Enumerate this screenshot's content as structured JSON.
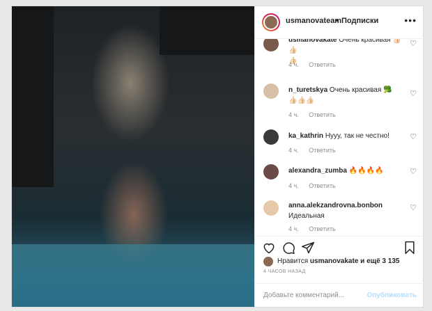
{
  "header": {
    "username": "usmanovateam",
    "separator": "•",
    "follow_label": "Подписки",
    "more_icon": "more-icon"
  },
  "comments": [
    {
      "user": "usmanovakate",
      "text": "Очень красивая 👍🏻👍🏻",
      "second_line": "👍🏻",
      "time": "4 ч.",
      "reply": "Ответить",
      "avatar_color": "#7a5a4a"
    },
    {
      "user": "n_turetskya",
      "text": "Очень красивая 🥦",
      "second_line": "👍🏻👍🏻👍🏻",
      "time": "4 ч.",
      "reply": "Ответить",
      "avatar_color": "#d7c0a8"
    },
    {
      "user": "ka_kathrin",
      "text": "Нууу, так не честно!",
      "time": "4 ч.",
      "reply": "Ответить",
      "avatar_color": "#3a3a3a"
    },
    {
      "user": "alexandra_zumba",
      "text": "🔥🔥🔥🔥",
      "time": "4 ч.",
      "reply": "Ответить",
      "avatar_color": "#6b4a48"
    },
    {
      "user": "anna.alekzandrovna.bonbon",
      "text": "",
      "second_line": "Идеальная",
      "time": "4 ч.",
      "reply": "Ответить",
      "avatar_color": "#e6c9a8"
    }
  ],
  "likes": {
    "prefix": "Нравится ",
    "user": "usmanovakate",
    "suffix": " и ещё 3 135"
  },
  "time_ago": "4 ЧАСОВ НАЗАД",
  "add_comment": {
    "placeholder": "Добавьте комментарий...",
    "publish_label": "Опубликовать"
  },
  "colors": {
    "text": "#262626",
    "muted": "#8e8e8e",
    "publish_disabled": "#b2dffc",
    "border": "#dbdbdb"
  }
}
